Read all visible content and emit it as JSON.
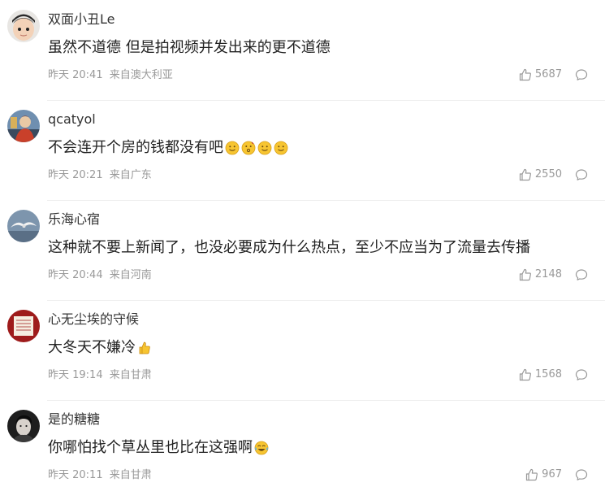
{
  "comments": [
    {
      "username": "双面小丑Le",
      "content": "虽然不道德 但是拍视频并发出来的更不道德",
      "time": "昨天 20:41",
      "location": "来自澳大利亚",
      "likes": "5687",
      "avatar": "child-avatar"
    },
    {
      "username": "qcatyol",
      "content": "不会连开个房的钱都没有吧",
      "emojis": [
        "smile-emoji",
        "thinking-emoji",
        "smile-emoji",
        "smile-emoji"
      ],
      "time": "昨天 20:21",
      "location": "来自广东",
      "likes": "2550",
      "avatar": "figure-avatar"
    },
    {
      "username": "乐海心宿",
      "content": "这种就不要上新闻了，也没必要成为什么热点，至少不应当为了流量去传播",
      "time": "昨天 20:44",
      "location": "来自河南",
      "likes": "2148",
      "avatar": "seagull-avatar"
    },
    {
      "username": "心无尘埃的守候",
      "content": "大冬天不嫌冷",
      "emojis": [
        "thumbs-up-emoji"
      ],
      "time": "昨天 19:14",
      "location": "来自甘肃",
      "likes": "1568",
      "avatar": "red-seal-avatar"
    },
    {
      "username": "是的糖糖",
      "content": "你哪怕找个草丛里也比在这强啊",
      "emojis": [
        "laughing-tears-emoji"
      ],
      "time": "昨天 20:11",
      "location": "来自甘肃",
      "likes": "967",
      "avatar": "portrait-avatar"
    }
  ],
  "icons": {
    "like": "thumbs-up-icon",
    "reply": "comment-bubble-icon"
  },
  "colors": {
    "meta_text": "#999999",
    "divider": "#eeeeee",
    "emoji_yellow": "#f7c531"
  }
}
